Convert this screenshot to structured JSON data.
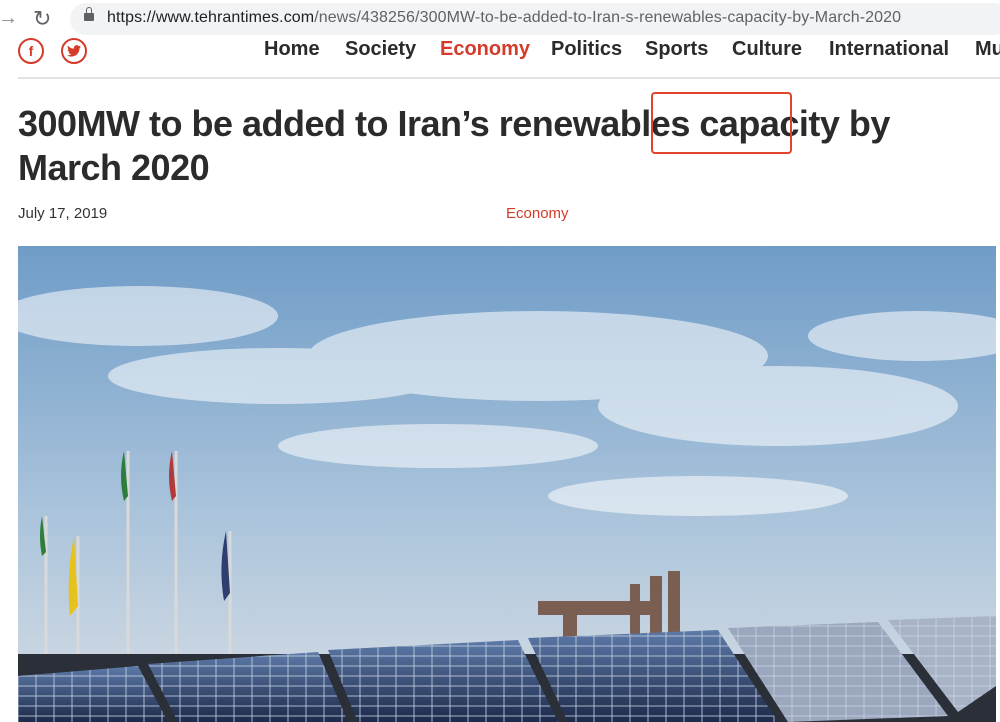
{
  "browser": {
    "url_host": "https://www.tehrantimes.com",
    "url_path": "/news/438256/300MW-to-be-added-to-Iran-s-renewables-capacity-by-March-2020"
  },
  "social": {
    "facebook": "f",
    "twitter": "🐦"
  },
  "nav": {
    "items": [
      "Home",
      "Society",
      "Economy",
      "Politics",
      "Sports",
      "Culture",
      "International",
      "Mu"
    ],
    "active": "Economy"
  },
  "article": {
    "title": "300MW to be added to Iran’s renewables capacity by March 2020",
    "date": "July 17, 2019",
    "category": "Economy"
  },
  "colors": {
    "accent": "#d43b2a",
    "highlight_box": "#e0442c",
    "text": "#2b2b2b"
  }
}
